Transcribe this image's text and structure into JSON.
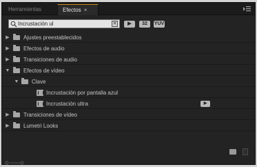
{
  "tabs": [
    {
      "label": "Herramientas",
      "active": false
    },
    {
      "label": "Efectos",
      "active": true
    }
  ],
  "tab_close_glyph": "×",
  "panel_menu_icon": "panel-menu-icon",
  "search": {
    "value": "Incrustación ul",
    "clear_glyph": "✕"
  },
  "toolbar_buttons": [
    {
      "name": "accelerated-effects-filter",
      "label": "▶"
    },
    {
      "name": "32-bit-filter",
      "label": "32"
    },
    {
      "name": "yuv-filter",
      "label": "YUV"
    }
  ],
  "tree": {
    "items": [
      {
        "label": "Ajustes preestablecidos",
        "expanded": false,
        "type": "folder"
      },
      {
        "label": "Efectos de audio",
        "expanded": false,
        "type": "folder"
      },
      {
        "label": "Transiciones de audio",
        "expanded": false,
        "type": "folder"
      },
      {
        "label": "Efectos de vídeo",
        "expanded": true,
        "type": "folder"
      },
      {
        "label": "Clave",
        "expanded": true,
        "type": "folder"
      },
      {
        "label": "Incrustación por pantalla azul",
        "type": "effect"
      },
      {
        "label": "Incrustación ultra",
        "type": "effect",
        "badge": "▶"
      },
      {
        "label": "Transiciones de vídeo",
        "expanded": false,
        "type": "folder"
      },
      {
        "label": "Lumetri Looks",
        "expanded": false,
        "type": "folder"
      }
    ]
  },
  "colors": {
    "panel_bg": "#232323",
    "active_tab_accent": "#c98a1b",
    "text": "#c6c6c6"
  }
}
